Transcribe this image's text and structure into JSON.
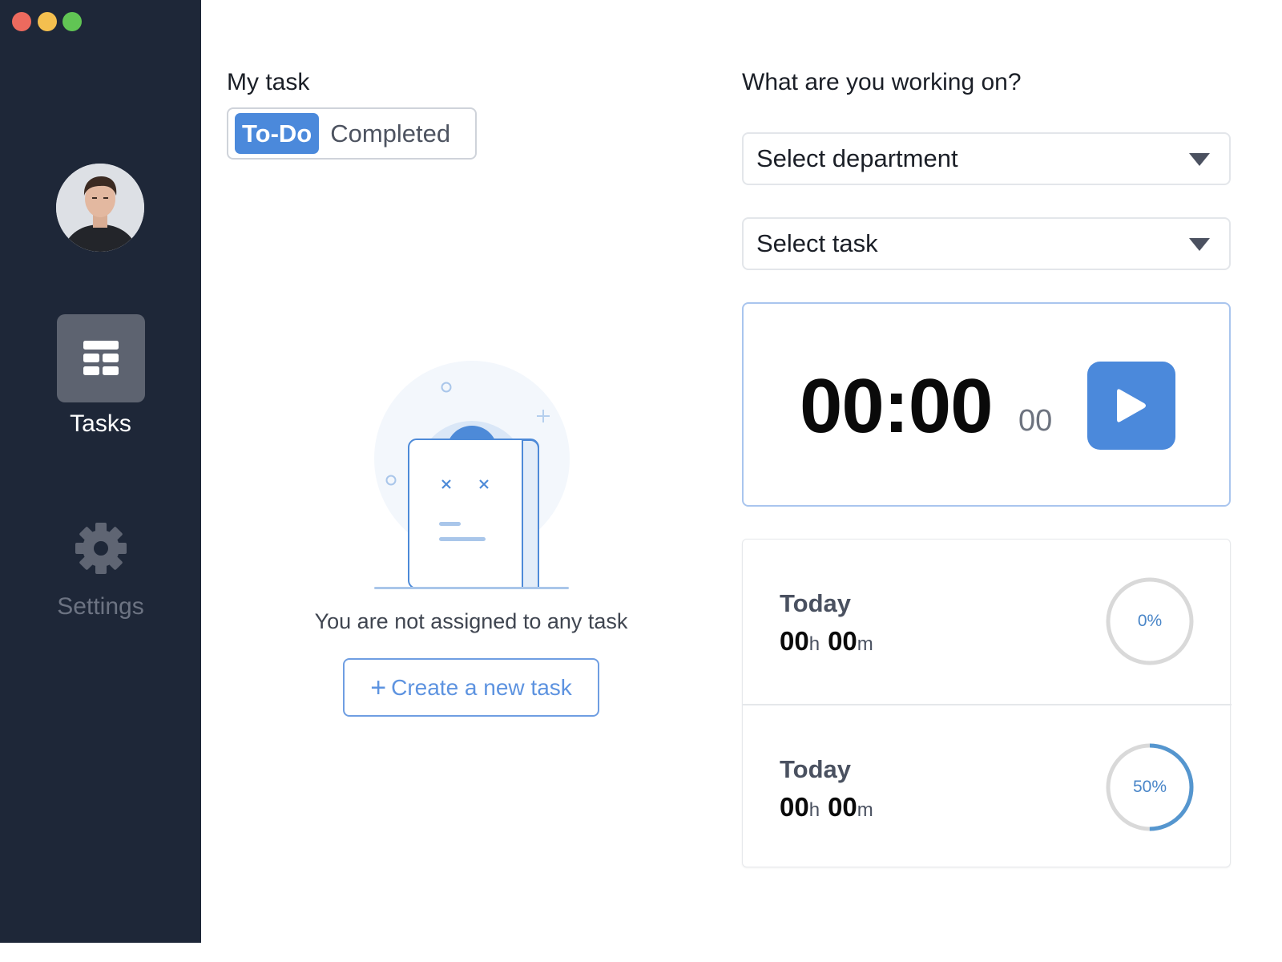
{
  "window": {
    "controls": [
      "close",
      "minimize",
      "zoom"
    ]
  },
  "sidebar": {
    "items": [
      {
        "label": "Tasks",
        "icon": "table-icon",
        "active": true
      },
      {
        "label": "Settings",
        "icon": "gear-icon",
        "active": false
      }
    ]
  },
  "tasks_panel": {
    "title": "My task",
    "tabs": [
      {
        "label": "To-Do",
        "active": true
      },
      {
        "label": "Completed",
        "active": false
      }
    ],
    "empty_message": "You are not assigned to any task",
    "create_button": {
      "icon": "plus-icon",
      "label": "Create a new task"
    }
  },
  "tracker": {
    "title": "What are you working on?",
    "department_select": {
      "value": "Select department"
    },
    "task_select": {
      "value": "Select task"
    },
    "timer": {
      "main": "00:00",
      "sub": "00"
    },
    "stats": [
      {
        "label": "Today",
        "hours": "00",
        "hours_unit": "h",
        "minutes": "00",
        "minutes_unit": "m",
        "progress_text": "0%",
        "progress": 0
      },
      {
        "label": "Today",
        "hours": "00",
        "hours_unit": "h",
        "minutes": "00",
        "minutes_unit": "m",
        "progress_text": "50%",
        "progress": 0.5
      }
    ]
  },
  "colors": {
    "sidebar_bg": "#1e2738",
    "accent": "#4b89db",
    "ring_track": "#d9d9d9",
    "ring_fill": "#5596cf"
  }
}
